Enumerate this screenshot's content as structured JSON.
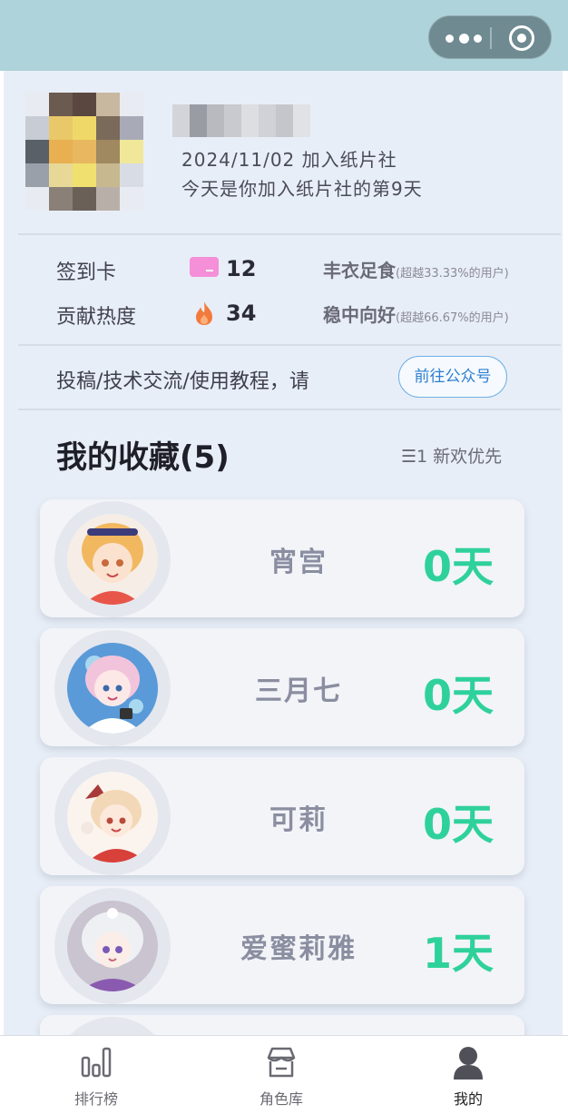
{
  "header": {
    "more_icon": "more-dots-icon",
    "close_icon": "target-circle-icon"
  },
  "profile": {
    "join_date": "2024/11/02 加入纸片社",
    "join_days": "今天是你加入纸片社的第9天"
  },
  "stats": {
    "checkin_label": "签到卡",
    "checkin_value": "12",
    "checkin_rank": "丰衣足食",
    "checkin_rank_note": "(超越33.33%的用户)",
    "heat_label": "贡献热度",
    "heat_value": "34",
    "heat_rank": "稳中向好",
    "heat_rank_note": "(超越66.67%的用户)"
  },
  "promo": {
    "text": "投稿/技术交流/使用教程，请",
    "button": "前往公众号"
  },
  "favorites": {
    "title": "我的收藏(5)",
    "sort_label": "☰1 新欢优先",
    "items": [
      {
        "name": "宵宫",
        "days": "0天"
      },
      {
        "name": "三月七",
        "days": "0天"
      },
      {
        "name": "可莉",
        "days": "0天"
      },
      {
        "name": "爱蜜莉雅",
        "days": "1天"
      }
    ]
  },
  "tabbar": {
    "tabs": [
      {
        "label": "排行榜"
      },
      {
        "label": "角色库"
      },
      {
        "label": "我的"
      }
    ]
  },
  "colors": {
    "accent_green": "#2fd19a",
    "header_bg": "#aed3da",
    "link_blue": "#2e7fd0"
  }
}
